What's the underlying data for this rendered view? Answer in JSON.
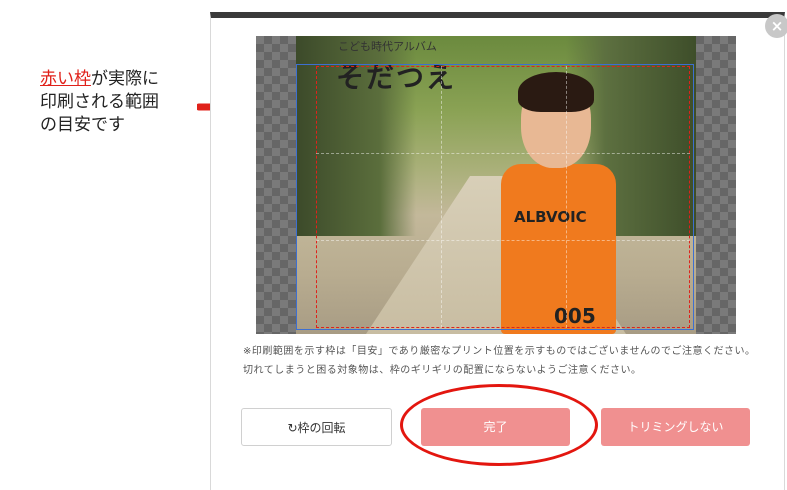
{
  "annotation": {
    "highlight": "赤い枠",
    "rest_line1": "が実際に",
    "line2": "印刷される範囲",
    "line3": "の目安です"
  },
  "modal": {
    "close_label": "×",
    "photo": {
      "subtitle": "こども時代アルバム",
      "title": "そだつえ",
      "shirt_text": "ALBVOIC",
      "shirt_number": "005"
    },
    "notes": [
      "※印刷範囲を示す枠は「目安」であり厳密なプリント位置を示すものではございませんのでご注意ください。",
      "切れてしまうと困る対象物は、枠のギリギリの配置にならないようご注意ください。"
    ],
    "buttons": {
      "rotate_icon": "↻",
      "rotate_label": "枠の回転",
      "done_label": "完了",
      "no_trim_label": "トリミングしない"
    }
  },
  "colors": {
    "accent_red": "#e0211a",
    "button_pink": "#f09090",
    "frame_blue": "#3d6fd1"
  }
}
